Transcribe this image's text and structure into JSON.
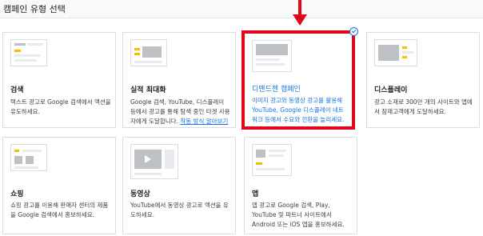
{
  "header": {
    "title": "캠페인 유형 선택"
  },
  "cards": [
    {
      "id": "search",
      "title": "검색",
      "desc": "텍스트 광고로 Google 검색에서 액션을 유도하세요."
    },
    {
      "id": "performance-max",
      "title": "실적 최대화",
      "desc": "Google 검색, YouTube, 디스플레이 등에서 광고를 통해 탐색 중인 타겟 사용자에게 도달합니다.",
      "link": "작동 방식 알아보기"
    },
    {
      "id": "demand-gen",
      "title": "디맨드젠 캠페인",
      "desc": "이미지 광고와 동영상 광고를 활용해 YouTube, Google 디스플레이 네트워크 등에서 수요와 전환을 늘리세요.",
      "selected": true
    },
    {
      "id": "display",
      "title": "디스플레이",
      "desc": "광고 소재로 300만 개의 사이트와 앱에서 잠재고객에게 도달하세요."
    },
    {
      "id": "shopping",
      "title": "쇼핑",
      "desc": "쇼핑 광고를 이용해 판매자 센터의 제품을 Google 검색에서 홍보하세요."
    },
    {
      "id": "video",
      "title": "동영상",
      "desc": "YouTube에서 동영상 광고로 액션을 유도하세요."
    },
    {
      "id": "app",
      "title": "앱",
      "desc": "앱 광고로 Google 검색, Play, YouTube 및 파트너 사이트에서 Android 또는 iOS 앱을 홍보하세요."
    }
  ],
  "colors": {
    "highlight": "#e3061a",
    "accent": "#1a73e8",
    "yellow": "#fbbc04"
  }
}
